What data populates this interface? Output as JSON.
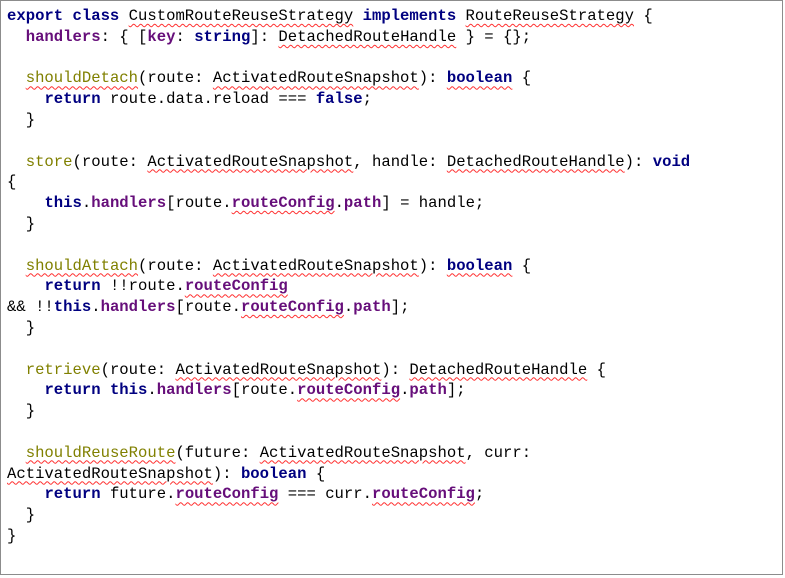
{
  "editor": {
    "lines": [
      [
        {
          "t": "export class ",
          "c": "kw"
        },
        {
          "t": "CustomRouteReuseStrategy",
          "c": "err"
        },
        {
          "t": " "
        },
        {
          "t": "implements",
          "c": "kw"
        },
        {
          "t": " "
        },
        {
          "t": "RouteReuseStrategy",
          "c": "err"
        },
        {
          "t": " {"
        }
      ],
      [
        {
          "t": "  "
        },
        {
          "t": "handlers",
          "c": "field"
        },
        {
          "t": ": { ["
        },
        {
          "t": "key",
          "c": "field"
        },
        {
          "t": ": "
        },
        {
          "t": "string",
          "c": "kw"
        },
        {
          "t": "]: "
        },
        {
          "t": "DetachedRouteHandle",
          "c": "err"
        },
        {
          "t": " } = {};"
        }
      ],
      [
        {
          "t": ""
        }
      ],
      [
        {
          "t": "  "
        },
        {
          "t": "shouldDetach",
          "c": "fn err"
        },
        {
          "t": "(route: "
        },
        {
          "t": "ActivatedRouteSnapshot",
          "c": "err"
        },
        {
          "t": "): "
        },
        {
          "t": "boolean",
          "c": "kw err"
        },
        {
          "t": " {"
        }
      ],
      [
        {
          "t": "    "
        },
        {
          "t": "return",
          "c": "kw"
        },
        {
          "t": " route.data.reload === "
        },
        {
          "t": "false",
          "c": "kw"
        },
        {
          "t": ";"
        }
      ],
      [
        {
          "t": "  }"
        }
      ],
      [
        {
          "t": ""
        }
      ],
      [
        {
          "t": "  "
        },
        {
          "t": "store",
          "c": "fn"
        },
        {
          "t": "(route: "
        },
        {
          "t": "ActivatedRouteSnapshot",
          "c": "err"
        },
        {
          "t": ", handle: "
        },
        {
          "t": "DetachedRouteHandle",
          "c": "err"
        },
        {
          "t": "): "
        },
        {
          "t": "void",
          "c": "kw"
        }
      ],
      [
        {
          "t": "{"
        }
      ],
      [
        {
          "t": "    "
        },
        {
          "t": "this",
          "c": "kw"
        },
        {
          "t": "."
        },
        {
          "t": "handlers",
          "c": "field"
        },
        {
          "t": "[route."
        },
        {
          "t": "routeConfig",
          "c": "field err"
        },
        {
          "t": "."
        },
        {
          "t": "path",
          "c": "field"
        },
        {
          "t": "] = handle;"
        }
      ],
      [
        {
          "t": "  }"
        }
      ],
      [
        {
          "t": ""
        }
      ],
      [
        {
          "t": "  "
        },
        {
          "t": "shouldAttach",
          "c": "fn err"
        },
        {
          "t": "(route: "
        },
        {
          "t": "ActivatedRouteSnapshot",
          "c": "err"
        },
        {
          "t": "): "
        },
        {
          "t": "boolean",
          "c": "kw err"
        },
        {
          "t": " {"
        }
      ],
      [
        {
          "t": "    "
        },
        {
          "t": "return",
          "c": "kw"
        },
        {
          "t": " !!route."
        },
        {
          "t": "routeConfig",
          "c": "field err"
        }
      ],
      [
        {
          "t": "&& !!"
        },
        {
          "t": "this",
          "c": "kw"
        },
        {
          "t": "."
        },
        {
          "t": "handlers",
          "c": "field"
        },
        {
          "t": "[route."
        },
        {
          "t": "routeConfig",
          "c": "field err"
        },
        {
          "t": "."
        },
        {
          "t": "path",
          "c": "field"
        },
        {
          "t": "];"
        }
      ],
      [
        {
          "t": "  }"
        }
      ],
      [
        {
          "t": ""
        }
      ],
      [
        {
          "t": "  "
        },
        {
          "t": "retrieve",
          "c": "fn"
        },
        {
          "t": "(route: "
        },
        {
          "t": "ActivatedRouteSnapshot",
          "c": "err"
        },
        {
          "t": "): "
        },
        {
          "t": "DetachedRouteHandle",
          "c": "err"
        },
        {
          "t": " {"
        }
      ],
      [
        {
          "t": "    "
        },
        {
          "t": "return this",
          "c": "kw"
        },
        {
          "t": "."
        },
        {
          "t": "handlers",
          "c": "field"
        },
        {
          "t": "[route."
        },
        {
          "t": "routeConfig",
          "c": "field err"
        },
        {
          "t": "."
        },
        {
          "t": "path",
          "c": "field"
        },
        {
          "t": "];"
        }
      ],
      [
        {
          "t": "  }"
        }
      ],
      [
        {
          "t": ""
        }
      ],
      [
        {
          "t": "  "
        },
        {
          "t": "shouldReuseRoute",
          "c": "fn err"
        },
        {
          "t": "(future: "
        },
        {
          "t": "ActivatedRouteSnapshot",
          "c": "err"
        },
        {
          "t": ", curr:"
        }
      ],
      [
        {
          "t": "ActivatedRouteSnapshot",
          "c": "err"
        },
        {
          "t": "): "
        },
        {
          "t": "boolean",
          "c": "kw"
        },
        {
          "t": " {"
        }
      ],
      [
        {
          "t": "    "
        },
        {
          "t": "return",
          "c": "kw"
        },
        {
          "t": " future."
        },
        {
          "t": "routeConfig",
          "c": "field err"
        },
        {
          "t": " === curr."
        },
        {
          "t": "routeConfig",
          "c": "field err"
        },
        {
          "t": ";"
        }
      ],
      [
        {
          "t": "  }"
        }
      ],
      [
        {
          "t": "}"
        }
      ]
    ]
  }
}
